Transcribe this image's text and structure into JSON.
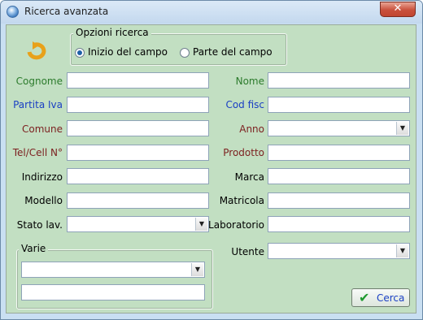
{
  "window": {
    "title": "Ricerca avanzata",
    "close_glyph": "✕"
  },
  "options": {
    "title": "Opzioni ricerca",
    "radio_start": "Inizio del campo",
    "radio_part": "Parte del campo",
    "selected": "Inizio del campo"
  },
  "labels": {
    "cognome": "Cognome",
    "nome": "Nome",
    "partita_iva": "Partita Iva",
    "cod_fisc": "Cod fisc",
    "comune": "Comune",
    "anno": "Anno",
    "tel": "Tel/Cell N°",
    "prodotto": "Prodotto",
    "indirizzo": "Indirizzo",
    "marca": "Marca",
    "modello": "Modello",
    "matricola": "Matricola",
    "stato_lav": "Stato lav.",
    "laboratorio": "Laboratorio",
    "varie": "Varie",
    "utente": "Utente"
  },
  "buttons": {
    "cerca": "Cerca"
  },
  "icons": {
    "app": "window-globe-icon",
    "refresh": "refresh-arrow-icon",
    "check": "checkmark-icon",
    "dropdown": "dropdown-arrow-icon"
  },
  "colors": {
    "background": "#c2dfc2",
    "label_green": "#2c7b2c",
    "label_blue": "#1a3fc4",
    "label_red": "#7c1f1f"
  }
}
